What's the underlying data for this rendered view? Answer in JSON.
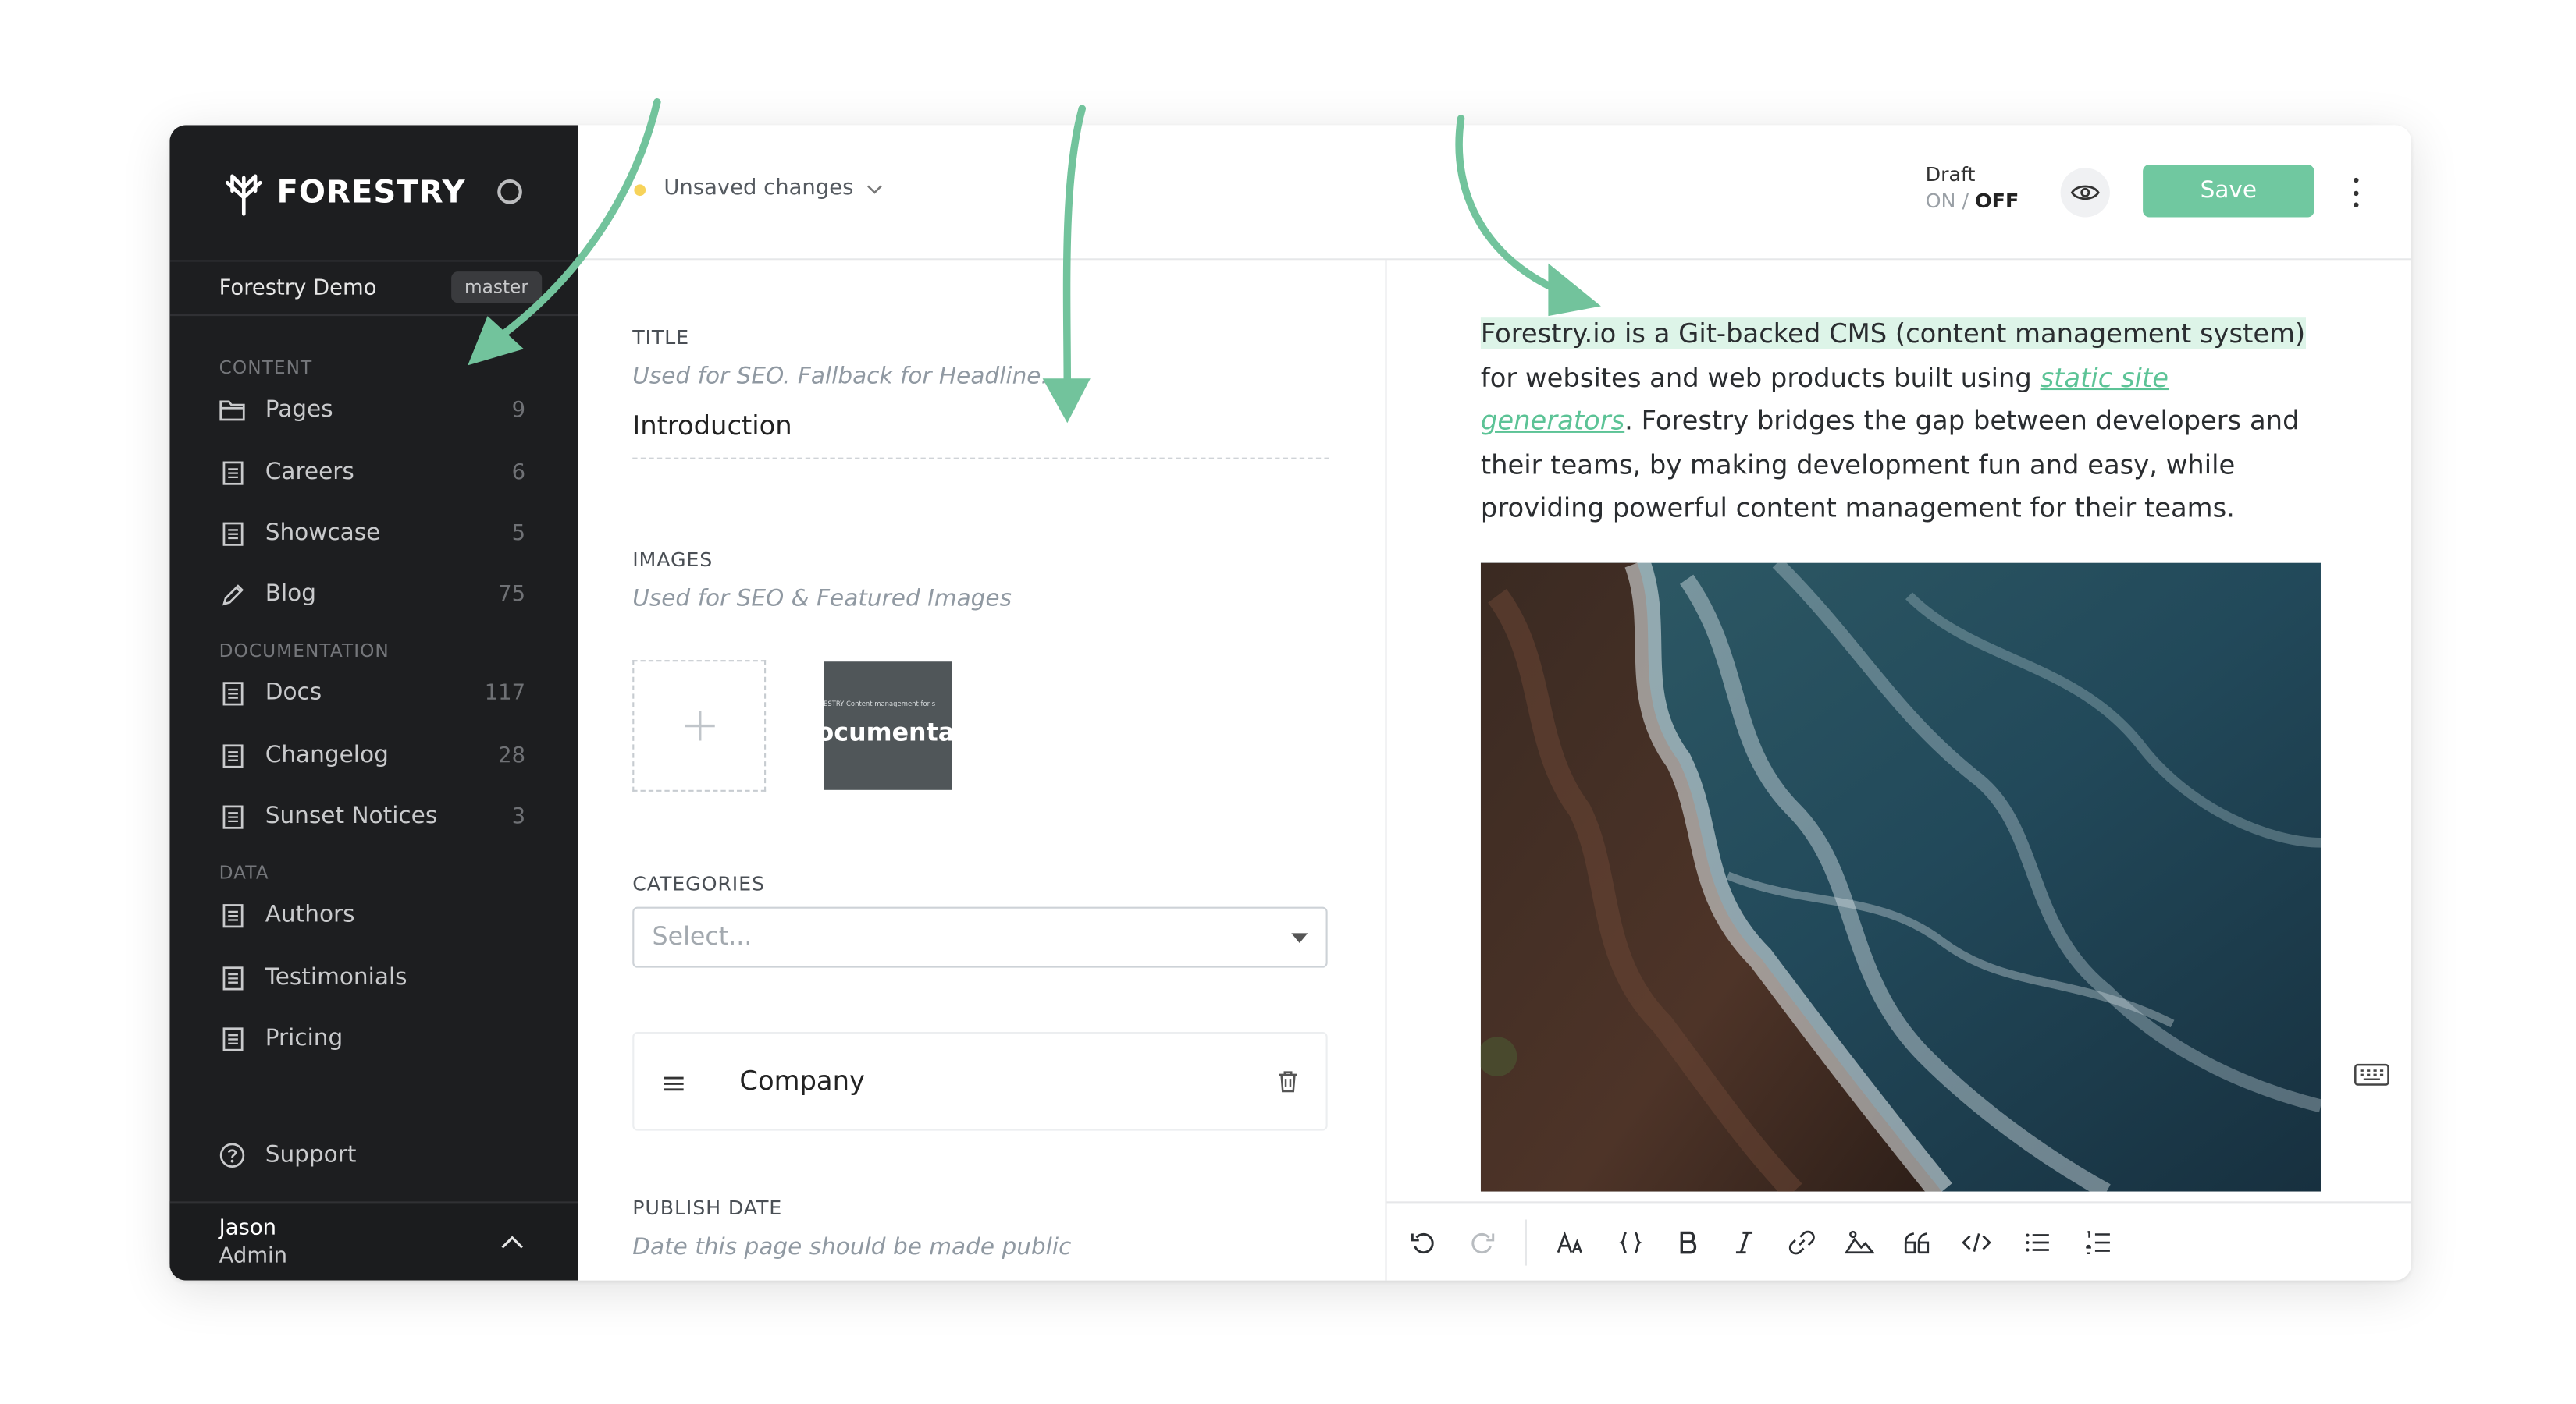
{
  "brand": {
    "name": "FORESTRY"
  },
  "site": {
    "name": "Forestry Demo",
    "branch": "master"
  },
  "sidebar": {
    "groups": [
      {
        "label": "CONTENT"
      },
      {
        "label": "DOCUMENTATION"
      },
      {
        "label": "DATA"
      }
    ],
    "items": [
      {
        "label": "Pages",
        "count": "9",
        "icon": "folder-icon"
      },
      {
        "label": "Careers",
        "count": "6",
        "icon": "document-icon"
      },
      {
        "label": "Showcase",
        "count": "5",
        "icon": "document-icon"
      },
      {
        "label": "Blog",
        "count": "75",
        "icon": "pencil-icon"
      },
      {
        "label": "Docs",
        "count": "117",
        "icon": "document-icon"
      },
      {
        "label": "Changelog",
        "count": "28",
        "icon": "document-icon"
      },
      {
        "label": "Sunset Notices",
        "count": "3",
        "icon": "document-icon"
      },
      {
        "label": "Authors",
        "count": "",
        "icon": "document-icon"
      },
      {
        "label": "Testimonials",
        "count": "",
        "icon": "document-icon"
      },
      {
        "label": "Pricing",
        "count": "",
        "icon": "document-icon"
      }
    ],
    "support": "Support",
    "user": {
      "name": "Jason",
      "role": "Admin"
    }
  },
  "topbar": {
    "status": "Unsaved changes",
    "draft_label": "Draft",
    "draft_on": "ON",
    "draft_sep": "/",
    "draft_off": "OFF",
    "save": "Save"
  },
  "form": {
    "title": {
      "label": "TITLE",
      "hint": "Used for SEO. Fallback for Headline.",
      "value": "Introduction"
    },
    "images": {
      "label": "IMAGES",
      "hint": "Used for SEO & Featured Images",
      "thumb_small": "ESTRY   Content management for s",
      "thumb_text": "ocumentati"
    },
    "categories": {
      "label": "CATEGORIES",
      "placeholder": "Select...",
      "items": [
        "Company"
      ]
    },
    "publish_date": {
      "label": "PUBLISH DATE",
      "hint": "Date this page should be made public"
    }
  },
  "content": {
    "highlighted": "Forestry.io is a Git-backed CMS (content management system)",
    "text_1": " for websites and web products built using ",
    "link": "static site generators",
    "text_2": ". Forestry bridges the gap between developers and their teams, by making development fun and easy, while providing powerful content management for their teams."
  },
  "toolbar": [
    "undo-icon",
    "redo-icon",
    "text-size-icon",
    "code-braces-icon",
    "bold-icon",
    "italic-icon",
    "link-icon",
    "image-icon",
    "quote-icon",
    "code-icon",
    "bullet-list-icon",
    "numbered-list-icon"
  ],
  "colors": {
    "accent": "#70c8a0",
    "sidebar": "#1d1e20",
    "unsaved_dot": "#f7d35a"
  }
}
